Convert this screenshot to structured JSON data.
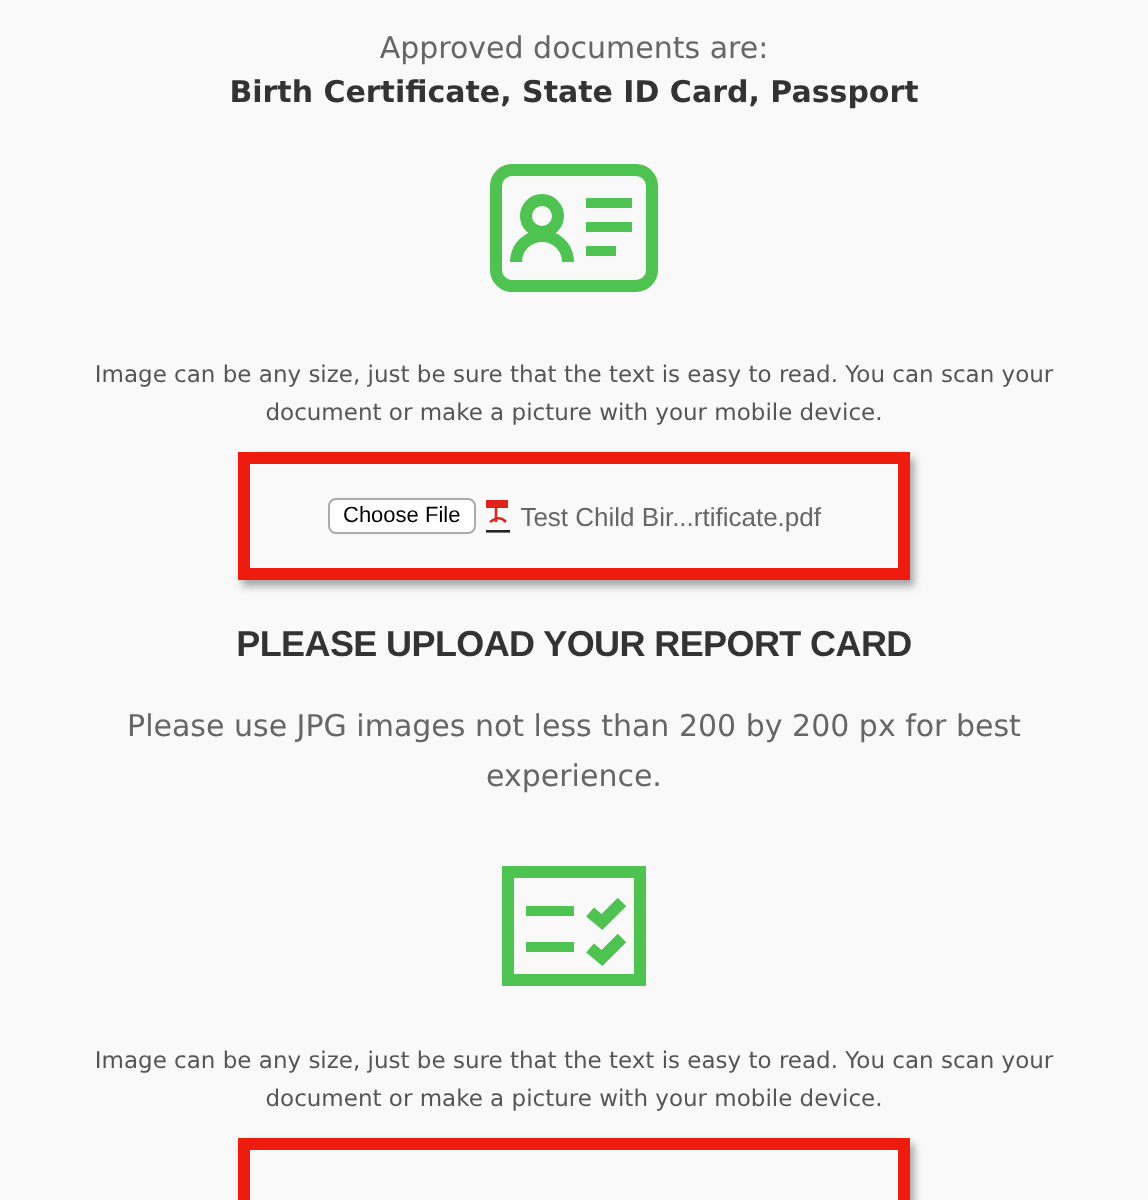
{
  "intro": {
    "label": "Approved documents are:",
    "documents": "Birth Certificate, State ID Card, Passport"
  },
  "sections": [
    {
      "kind": "id-card",
      "hint": "Image can be any size, just be sure that the text is easy to read. You can scan your document or make a picture with your mobile device.",
      "upload": {
        "button": "Choose File",
        "file_name": "Test Child Bir...rtificate.pdf"
      }
    },
    {
      "heading": "PLEASE UPLOAD YOUR REPORT CARD",
      "subtitle": "Please use JPG images not less than 200 by 200 px for best experience.",
      "kind": "checklist",
      "hint": "Image can be any size, just be sure that the text is easy to read. You can scan your document or make a picture with your mobile device."
    }
  ]
}
